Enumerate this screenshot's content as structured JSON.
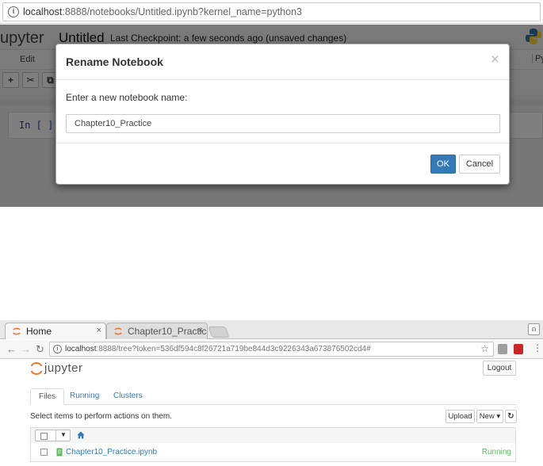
{
  "top": {
    "address": {
      "host": "localhost",
      "path": ":8888/notebooks/Untitled.ipynb?kernel_name=python3"
    },
    "notebook": {
      "logo_text": "upyter",
      "title": "Untitled",
      "checkpoint": "Last Checkpoint: a few seconds ago (unsaved changes)",
      "menu_edit": "Edit",
      "menu_right": "Py",
      "cell_prompt": "In [ ]:"
    },
    "toolbar": {
      "add": "+",
      "cut": "✂",
      "copy": "⧉"
    },
    "modal": {
      "title": "Rename Notebook",
      "close": "×",
      "label": "Enter a new notebook name:",
      "input_value": "Chapter10_Practice",
      "ok": "OK",
      "cancel": "Cancel"
    }
  },
  "bottom": {
    "tabs": [
      {
        "label": "Home",
        "close": "×"
      },
      {
        "label": "Chapter10_Practic",
        "close": "×"
      }
    ],
    "address": {
      "host": "localhost",
      "path": ":8888/tree?token=536df594c8f26721a719be844d3c9226343a673876502cd4#"
    },
    "nav": {
      "back": "←",
      "forward": "→",
      "reload": "↻",
      "star": "☆",
      "menu": "⋮",
      "profile": "⍝"
    },
    "page": {
      "logo_text": "jupyter",
      "logout": "Logout",
      "nav_tabs": [
        "Files",
        "Running",
        "Clusters"
      ],
      "select_text": "Select items to perform actions on them.",
      "upload": "Upload",
      "new": "New ▾",
      "refresh": "↻",
      "caret": "▼",
      "file_name": "Chapter10_Practice.ipynb",
      "file_status": "Running"
    }
  },
  "colors": {
    "primary": "#337ab7",
    "running": "#5cb85c",
    "jupyter_orange": "#f37626",
    "python_blue": "#3572a5",
    "python_yellow": "#ffd43b"
  }
}
